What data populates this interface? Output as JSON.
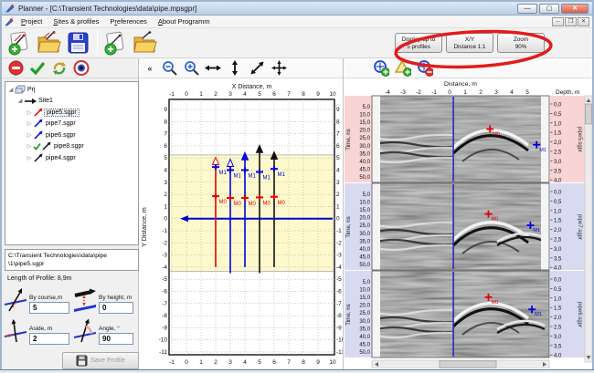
{
  "window": {
    "title": "Planner - [C:\\Transient Technologies\\data\\pipe.mpsgpr]"
  },
  "menu": {
    "items": [
      {
        "label": "Project",
        "u": 0
      },
      {
        "label": "Sites & profiles",
        "u": 0
      },
      {
        "label": "Preferences",
        "u": 1
      },
      {
        "label": "About Programm",
        "u": 0
      }
    ]
  },
  "toolbar_right": {
    "buttons": [
      {
        "line1": "Display up to",
        "line2": "5 profiles"
      },
      {
        "line1": "X/Y",
        "line2": "Distance 1:1"
      },
      {
        "line1": "Zoom",
        "line2": "90%"
      }
    ]
  },
  "toolbar_mid": {
    "collapse": "«"
  },
  "tree": {
    "root": "Prj",
    "site": "Site1",
    "profiles": [
      {
        "name": "pipe5.sgpr",
        "color": "#e00000",
        "selected": true,
        "checked": false
      },
      {
        "name": "pipe7.sgpr",
        "color": "#0000e0",
        "selected": false,
        "checked": false
      },
      {
        "name": "pipe6.sgpr",
        "color": "#0000e0",
        "selected": false,
        "checked": false
      },
      {
        "name": "pipe8.sgpr",
        "color": "#111111",
        "selected": false,
        "checked": true
      },
      {
        "name": "pipe4.sgpr",
        "color": "#111111",
        "selected": false,
        "checked": false
      }
    ]
  },
  "info": {
    "path_line1": "C:\\Transient Technologies\\data\\pipe",
    "path_line2": "\\1\\pipe5.sgpr",
    "length_label": "Length of Profile: 8,9m",
    "fields": [
      {
        "label": "By course,m",
        "value": "5",
        "icon": "by-course"
      },
      {
        "label": "By height, m",
        "value": "0",
        "icon": "by-height"
      },
      {
        "label": "Aside, m",
        "value": "2",
        "icon": "aside"
      },
      {
        "label": "Angle, °",
        "value": "90",
        "icon": "angle"
      }
    ],
    "save_label": "Save Profile"
  },
  "plan": {
    "title": "X Distance, m",
    "ylabel": "Y Distance, m",
    "x_ticks": [
      -1,
      0,
      1,
      2,
      3,
      4,
      5,
      6,
      7,
      8,
      9,
      10
    ],
    "y_ticks": [
      9,
      8,
      7,
      6,
      5,
      4,
      3,
      2,
      1,
      0,
      -1,
      -2,
      -3,
      -4,
      -5,
      -6,
      -7,
      -8,
      -9,
      -10,
      -11
    ],
    "band": {
      "y_top": 5.25,
      "y_bottom": -4.35,
      "color": "#fdf9cd"
    },
    "baseline": {
      "y": 0,
      "x_start": 0,
      "x_end": 10,
      "color": "#0000cc"
    },
    "profiles": [
      {
        "x": 2,
        "y_from": -4.0,
        "y_to": 5.05,
        "color": "#e00000",
        "m1_y": 4.25,
        "m0_y": 1.85,
        "head": "open"
      },
      {
        "x": 3,
        "y_from": -4.5,
        "y_to": 4.9,
        "color": "#0000e0",
        "m1_y": 4.0,
        "m0_y": 1.7,
        "head": "open"
      },
      {
        "x": 4,
        "y_from": -4.0,
        "y_to": 5.45,
        "color": "#0000e0",
        "m1_y": 4.0,
        "m0_y": 1.7,
        "head": "filled"
      },
      {
        "x": 5,
        "y_from": -4.5,
        "y_to": 6.05,
        "color": "#111111",
        "m1_y": 3.85,
        "m0_y": 1.75,
        "head": "filled"
      },
      {
        "x": 6,
        "y_from": -4.0,
        "y_to": 5.5,
        "color": "#111111",
        "m1_y": 4.1,
        "m0_y": 1.8,
        "head": "filled"
      }
    ],
    "m0_label": "M0",
    "m1_label": "M1",
    "m0_color": "#e00000",
    "m1_color": "#0000e0"
  },
  "radar": {
    "distance_label": "Distance, m",
    "depth_label": "Depth, m",
    "time_label": "Time, ns",
    "distance_ticks": [
      -4,
      -3,
      -2,
      -1,
      0,
      1,
      2,
      3,
      4,
      5
    ],
    "time_ticks": [
      "5,0",
      "10,0",
      "15,0",
      "20,0",
      "25,0",
      "30,0",
      "35,0",
      "40,0",
      "45,0",
      "50,0"
    ],
    "depth_ticks": [
      "0,0",
      "0,5",
      "1,0",
      "1,5",
      "2,0",
      "2,5",
      "3,0",
      "3,5",
      "4,0"
    ],
    "m0_label": "M0",
    "m1_label": "M1",
    "cursor_x": 0.24,
    "sections": [
      {
        "name": "pipe5.sgpr",
        "band": "#f8d4d4",
        "m0": {
          "x": 2.6,
          "fy": 0.38
        },
        "m1": {
          "x": 5.6,
          "fy": 0.56
        }
      },
      {
        "name": "pipe7.sgpr",
        "band": "#d9daf2",
        "m0": {
          "x": 2.5,
          "fy": 0.35
        },
        "m1": {
          "x": 5.2,
          "fy": 0.48
        }
      },
      {
        "name": "pipe6.sgpr",
        "band": "#d9daf2",
        "m0": {
          "x": 2.5,
          "fy": 0.3
        },
        "m1": {
          "x": 5.3,
          "fy": 0.44
        }
      }
    ]
  }
}
